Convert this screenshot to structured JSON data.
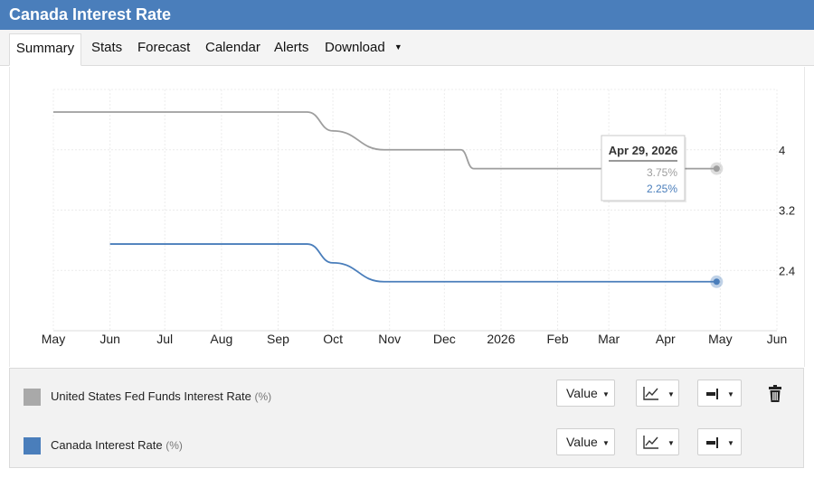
{
  "header": {
    "title": "Canada Interest Rate"
  },
  "tabs": [
    {
      "label": "Summary",
      "active": true
    },
    {
      "label": "Stats"
    },
    {
      "label": "Forecast"
    },
    {
      "label": "Calendar"
    },
    {
      "label": "Alerts"
    },
    {
      "label": "Download",
      "has_dropdown": true
    }
  ],
  "chart_data": {
    "type": "line",
    "x_labels": [
      "May",
      "Jun",
      "Jul",
      "Aug",
      "Sep",
      "Oct",
      "Nov",
      "Dec",
      "2026",
      "Feb",
      "Mar",
      "Apr",
      "May",
      "Jun"
    ],
    "y_ticks": [
      2.4,
      3.2,
      4
    ],
    "y_axis_side": "right",
    "ylim": [
      1.6,
      4.8
    ],
    "grid": true,
    "series": [
      {
        "name": "United States Fed Funds Interest Rate",
        "color": "#9e9e9e",
        "points": [
          {
            "x": "2025-05-01",
            "y": 4.5
          },
          {
            "x": "2025-09-17",
            "y": 4.5
          },
          {
            "x": "2025-10-01",
            "y": 4.25
          },
          {
            "x": "2025-10-29",
            "y": 4.0
          },
          {
            "x": "2025-12-10",
            "y": 4.0
          },
          {
            "x": "2025-12-17",
            "y": 3.75
          },
          {
            "x": "2026-04-29",
            "y": 3.75
          }
        ]
      },
      {
        "name": "Canada Interest Rate",
        "color": "#4a7ebb",
        "points": [
          {
            "x": "2025-06-01",
            "y": 2.75
          },
          {
            "x": "2025-09-17",
            "y": 2.75
          },
          {
            "x": "2025-10-01",
            "y": 2.5
          },
          {
            "x": "2025-10-29",
            "y": 2.25
          },
          {
            "x": "2026-04-29",
            "y": 2.25
          }
        ]
      }
    ],
    "tooltip": {
      "title": "Apr 29, 2026",
      "values": [
        "3.75%",
        "2.25%"
      ]
    }
  },
  "legend": [
    {
      "label": "United States Fed Funds Interest Rate",
      "unit": "(%)",
      "color": "#a9a9a9",
      "value_label": "Value",
      "deletable": true
    },
    {
      "label": "Canada Interest Rate",
      "unit": "(%)",
      "color": "#4a7ebb",
      "value_label": "Value",
      "deletable": false
    }
  ]
}
